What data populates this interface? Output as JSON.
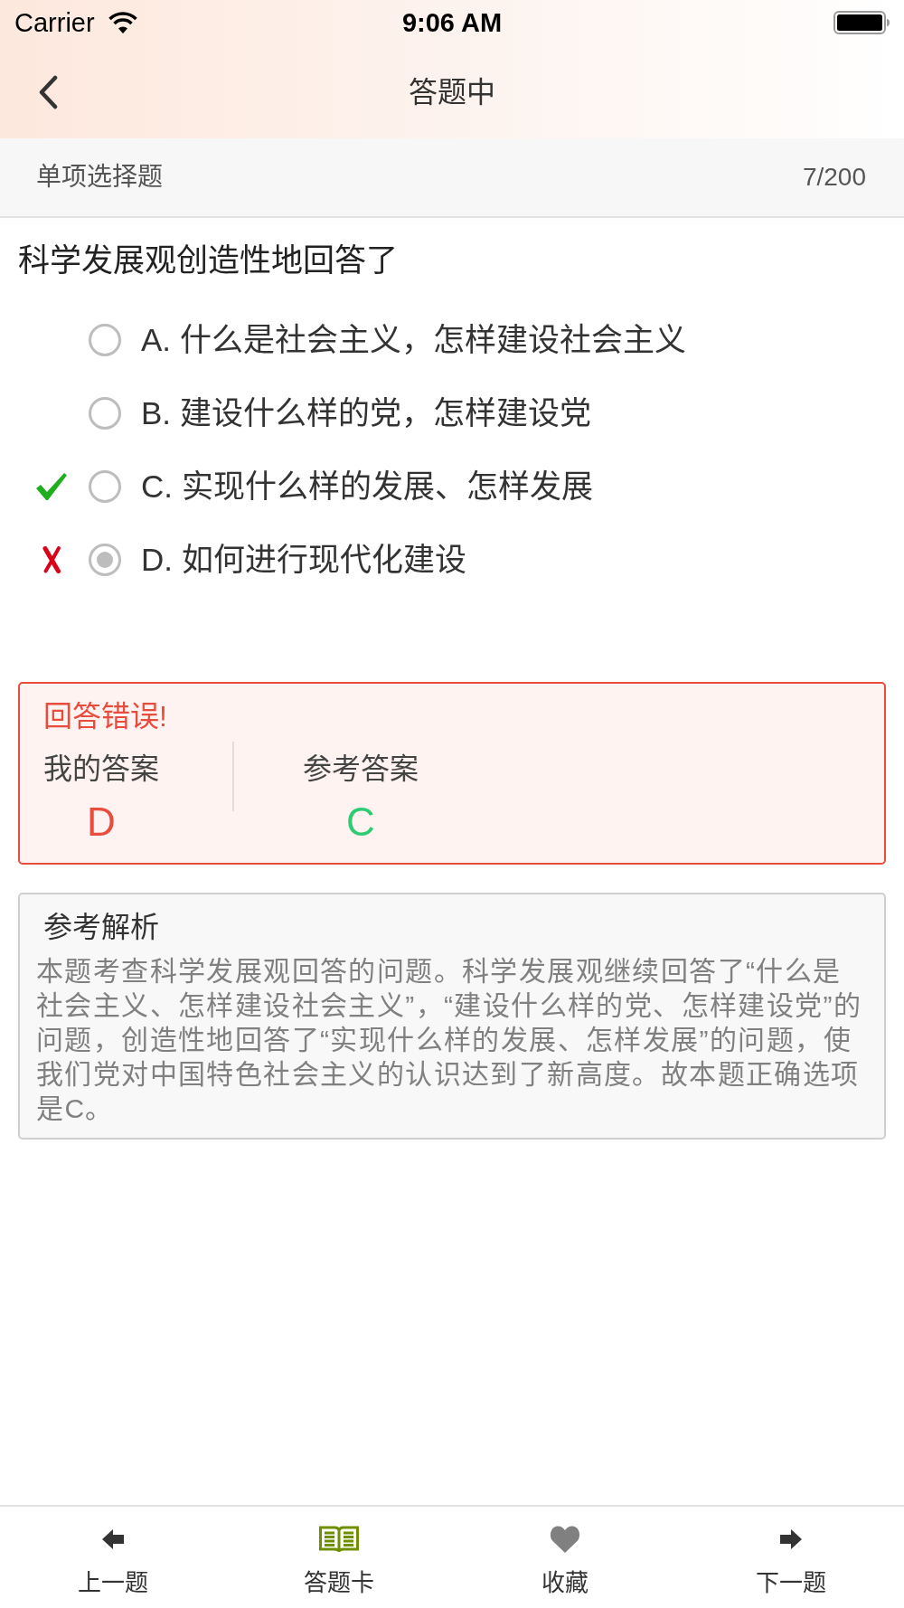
{
  "status_bar": {
    "carrier": "Carrier",
    "time": "9:06 AM"
  },
  "nav_bar": {
    "title": "答题中"
  },
  "question_bar": {
    "type": "单项选择题",
    "counter": "7/200"
  },
  "question": {
    "text": "科学发展观创造性地回答了",
    "options": [
      {
        "label": "A. 什么是社会主义，怎样建设社会主义",
        "selected": false,
        "correct": false
      },
      {
        "label": "B. 建设什么样的党，怎样建设党",
        "selected": false,
        "correct": false
      },
      {
        "label": "C. 实现什么样的发展、怎样发展",
        "selected": false,
        "correct": true
      },
      {
        "label": "D. 如何进行现代化建设",
        "selected": true,
        "correct": false
      }
    ]
  },
  "result": {
    "correct": false,
    "title": "回答错误!",
    "my_answer_label": "我的答案",
    "my_answer": "D",
    "reference_label": "参考答案",
    "reference_answer": "C"
  },
  "analysis": {
    "title": "参考解析",
    "text": "本题考查科学发展观回答的问题。科学发展观继续回答了“什么是社会主义、怎样建设社会主义”，“建设什么样的党、怎样建设党”的问题，创造性地回答了“实现什么样的发展、怎样发展”的问题，使我们党对中国特色社会主义的认识达到了新高度。故本题正确选项是C。"
  },
  "toolbar": [
    {
      "kind": "prev",
      "label": "上一题"
    },
    {
      "kind": "card",
      "label": "答题卡"
    },
    {
      "kind": "favorite",
      "label": "收藏",
      "favorited": false
    },
    {
      "kind": "next",
      "label": "下一题"
    }
  ]
}
